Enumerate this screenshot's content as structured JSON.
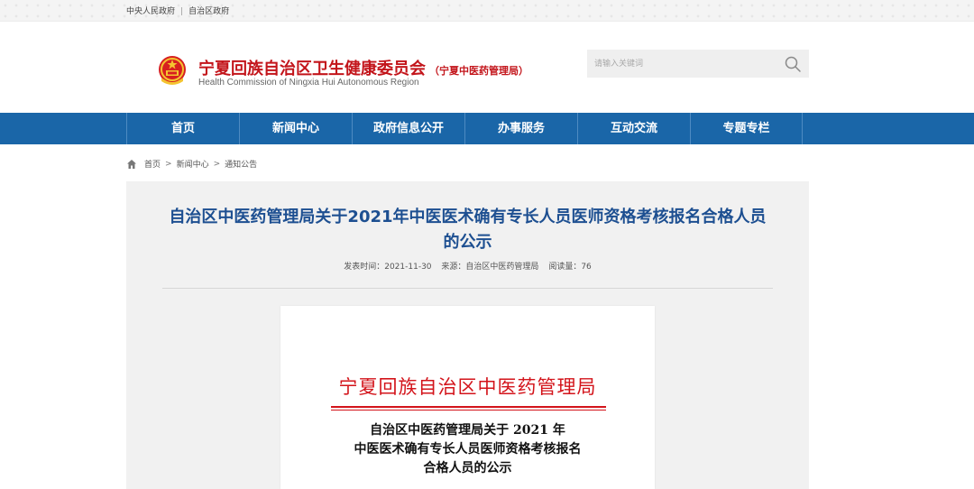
{
  "topbar": {
    "links": [
      "中央人民政府",
      "自治区政府"
    ],
    "separator": "|"
  },
  "header": {
    "title": "宁夏回族自治区卫生健康委员会",
    "subtitle": "（宁夏中医药管理局）",
    "title_en": "Health Commission of Ningxia Hui Autonomous Region",
    "emblem_icon": "national-emblem-icon"
  },
  "search": {
    "placeholder": "请输入关键词",
    "icon": "search-icon"
  },
  "nav": {
    "items": [
      "首页",
      "新闻中心",
      "政府信息公开",
      "办事服务",
      "互动交流",
      "专题专栏"
    ],
    "bg_color": "#1a66a8"
  },
  "breadcrumb": {
    "items": [
      "首页",
      "新闻中心",
      "通知公告"
    ],
    "separator": ">"
  },
  "article": {
    "title": "自治区中医药管理局关于2021年中医医术确有专长人员医师资格考核报名合格人员的公示",
    "publish_label": "发表时间：2021-11-30",
    "source_label": "来源：自治区中医药管理局",
    "views_label": "阅读量：76",
    "title_color": "#1d4f91"
  },
  "document": {
    "org_header": "宁夏回族自治区中医药管理局",
    "title_lines": [
      "自治区中医药管理局关于 2021 年",
      "中医医术确有专长人员医师资格考核报名",
      "合格人员的公示"
    ],
    "header_color": "#d3141b"
  }
}
